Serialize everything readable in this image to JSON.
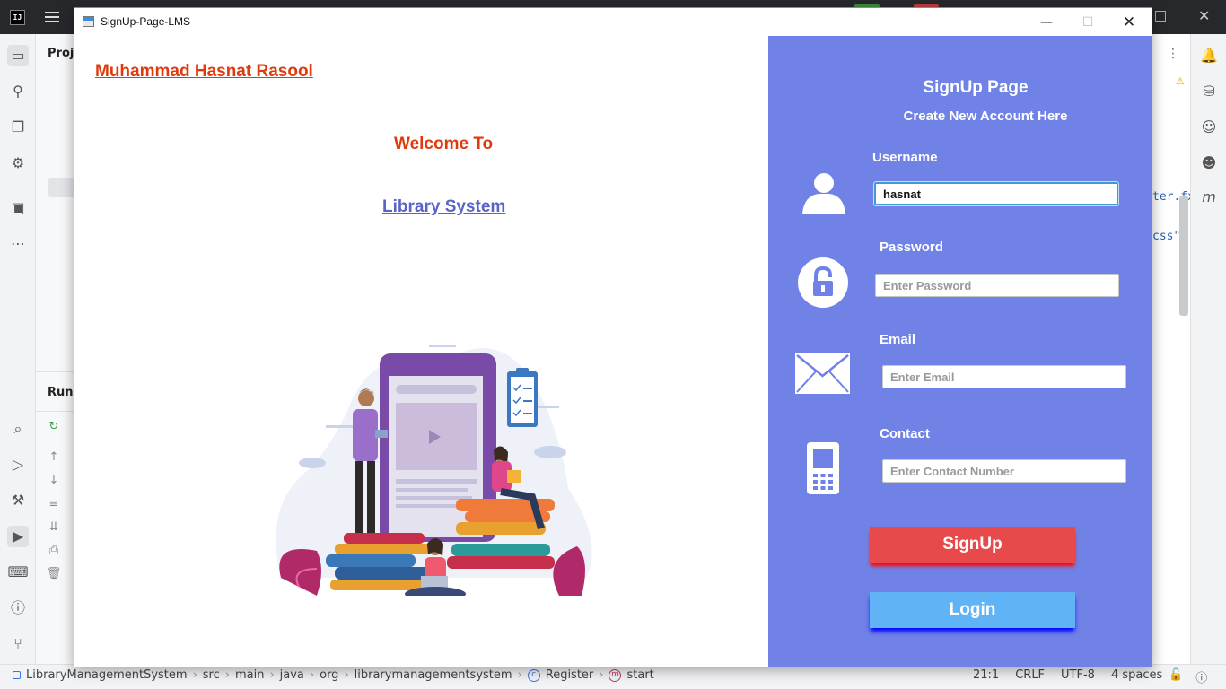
{
  "ide": {
    "logo": "IJ",
    "project_label": "Proje",
    "run_label": "Run",
    "code_fragment_1": "ter.fx",
    "code_fragment_2": "css\")",
    "breadcrumbs": [
      "LibraryManagementSystem",
      "src",
      "main",
      "java",
      "org",
      "librarymanagementsystem",
      "Register",
      "start"
    ],
    "status": {
      "position": "21:1",
      "line_ending": "CRLF",
      "encoding": "UTF-8",
      "indent": "4 spaces"
    }
  },
  "window": {
    "title": "SignUp-Page-LMS"
  },
  "left": {
    "author": "Muhammad Hasnat Rasool",
    "welcome": "Welcome To",
    "library": "Library System"
  },
  "form": {
    "title": "SignUp Page",
    "subtitle": "Create New Account Here",
    "username_label": "Username",
    "username_value": "hasnat",
    "password_label": "Password",
    "password_placeholder": "Enter Password",
    "email_label": "Email",
    "email_placeholder": "Enter Email",
    "contact_label": "Contact",
    "contact_placeholder": "Enter Contact Number",
    "signup_button": "SignUp",
    "login_button": "Login"
  },
  "colors": {
    "panel_bg": "#7082e6",
    "accent_red": "#e03a0c",
    "signup_button": "#e8494a",
    "login_button": "#60b4f6",
    "library_link": "#5a63c9"
  }
}
